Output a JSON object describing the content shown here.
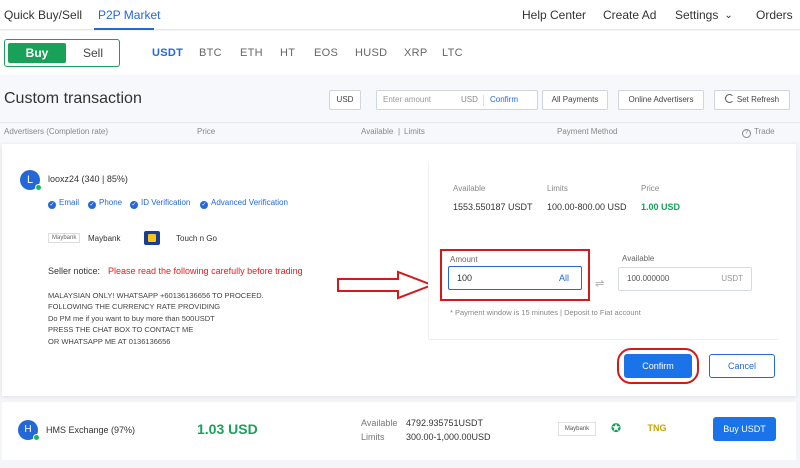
{
  "nav": {
    "quick": "Quick Buy/Sell",
    "p2p": "P2P Market",
    "help": "Help Center",
    "create": "Create Ad",
    "settings": "Settings",
    "orders": "Orders"
  },
  "trade_mode": {
    "buy": "Buy",
    "sell": "Sell"
  },
  "coins": [
    "USDT",
    "BTC",
    "ETH",
    "HT",
    "EOS",
    "HUSD",
    "XRP",
    "LTC"
  ],
  "custom": {
    "title": "Custom transaction",
    "currency": "USD",
    "amount_placeholder": "Enter amount",
    "amount_currency": "USD",
    "confirm": "Confirm",
    "payments": "All Payments",
    "online": "Online Advertisers",
    "refresh": "Set Refresh"
  },
  "columns": {
    "advertiser": "Advertisers (Completion rate)",
    "price": "Price",
    "available": "Available",
    "limits": "Limits",
    "payment": "Payment Method",
    "trade": "Trade"
  },
  "expanded": {
    "avatar": "L",
    "name": "looxz24 (340 | 85%)",
    "verifications": [
      "Email",
      "Phone",
      "ID Verification",
      "Advanced Verification"
    ],
    "payments": [
      "Maybank",
      "Touch n Go"
    ],
    "maybank_logo": "Maybank",
    "notice_label": "Seller notice:",
    "notice_text": "Please read the following carefully before trading",
    "terms": [
      "MALAYSIAN ONLY! WHATSAPP +60136136656 TO PROCEED.",
      "FOLLOWING THE CURRENCY RATE PROVIDING",
      "Do PM me if you want to buy more than 500USDT",
      "PRESS THE CHAT BOX TO CONTACT ME",
      "OR WHATSAPP ME AT 0136136656"
    ],
    "available_label": "Available",
    "available_value": "1553.550187 USDT",
    "limits_label": "Limits",
    "limits_value": "100.00-800.00 USD",
    "price_label": "Price",
    "price_value": "1.00 USD",
    "amount_label": "Amount",
    "amount_value": "100",
    "all": "All",
    "avail_field_label": "Available",
    "avail_field_value": "100.000000",
    "avail_field_currency": "USDT",
    "payment_note": "* Payment window is 15 minutes  |  Deposit to Fiat account",
    "confirm": "Confirm",
    "cancel": "Cancel"
  },
  "row2": {
    "avatar": "H",
    "name": "HMS Exchange (97%)",
    "price": "1.03 USD",
    "available_label": "Available",
    "available_value": "4792.935751USDT",
    "limits_label": "Limits",
    "limits_value": "300.00-1,000.00USD",
    "payment_logos": [
      "Maybank",
      "",
      "TNG"
    ],
    "buy": "Buy USDT"
  },
  "colors": {
    "primary": "#1a73e8",
    "green": "#1aa05a",
    "annotation_red": "#d11a1a"
  }
}
